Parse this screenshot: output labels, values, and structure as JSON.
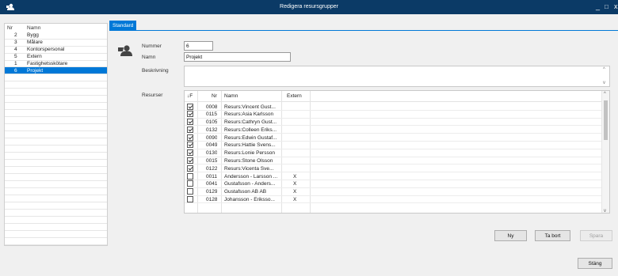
{
  "window": {
    "title": "Redigera resursgrupper",
    "minimize_glyph": "_",
    "maximize_glyph": "□",
    "close_glyph": "x"
  },
  "group_list": {
    "headers": {
      "nr": "Nr",
      "name": "Namn"
    },
    "rows": [
      {
        "nr": "2",
        "name": "Bygg"
      },
      {
        "nr": "3",
        "name": "Målare"
      },
      {
        "nr": "4",
        "name": "Kontorspersonal"
      },
      {
        "nr": "5",
        "name": "Extern"
      },
      {
        "nr": "1",
        "name": "Fastighetsskötare"
      },
      {
        "nr": "6",
        "name": "Projekt"
      }
    ],
    "selected_index": 5
  },
  "tabs": [
    {
      "label": "Standard"
    }
  ],
  "form": {
    "number_label": "Nummer",
    "number_value": "6",
    "name_label": "Namn",
    "name_value": "Projekt",
    "description_label": "Beskrivning",
    "description_value": "",
    "resources_label": "Resurser"
  },
  "resources": {
    "headers": {
      "sort": "↓F",
      "nr": "Nr",
      "name": "Namn",
      "extern": "Extern"
    },
    "rows": [
      {
        "checked": true,
        "nr": "0008",
        "name": "Resurs:Vincent Gust...",
        "extern": ""
      },
      {
        "checked": true,
        "nr": "0115",
        "name": "Resurs:Asia Karlsson",
        "extern": ""
      },
      {
        "checked": true,
        "nr": "0105",
        "name": "Resurs:Cathryn Gust...",
        "extern": ""
      },
      {
        "checked": true,
        "nr": "0132",
        "name": "Resurs:Colleen Eriks...",
        "extern": ""
      },
      {
        "checked": true,
        "nr": "0090",
        "name": "Resurs:Edwin Gustaf...",
        "extern": ""
      },
      {
        "checked": true,
        "nr": "0049",
        "name": "Resurs:Hattie Svens...",
        "extern": ""
      },
      {
        "checked": true,
        "nr": "0130",
        "name": "Resurs:Lonie Persson",
        "extern": ""
      },
      {
        "checked": true,
        "nr": "0015",
        "name": "Resurs:Stone Olsson",
        "extern": ""
      },
      {
        "checked": true,
        "nr": "0122",
        "name": "Resurs:Vicenta Sve...",
        "extern": ""
      },
      {
        "checked": false,
        "nr": "0011",
        "name": "Andersson - Larsson ...",
        "extern": "X"
      },
      {
        "checked": false,
        "nr": "0041",
        "name": "Gustafsson - Anders...",
        "extern": "X"
      },
      {
        "checked": false,
        "nr": "0129",
        "name": "Gustafsson AB AB",
        "extern": "X"
      },
      {
        "checked": false,
        "nr": "0128",
        "name": "Johansson - Eriksso...",
        "extern": "X"
      }
    ]
  },
  "buttons": {
    "new": "Ny",
    "delete": "Ta bort",
    "save": "Spara",
    "close": "Stäng"
  },
  "colors": {
    "titlebar": "#0b3a66",
    "accent": "#0078d7"
  }
}
